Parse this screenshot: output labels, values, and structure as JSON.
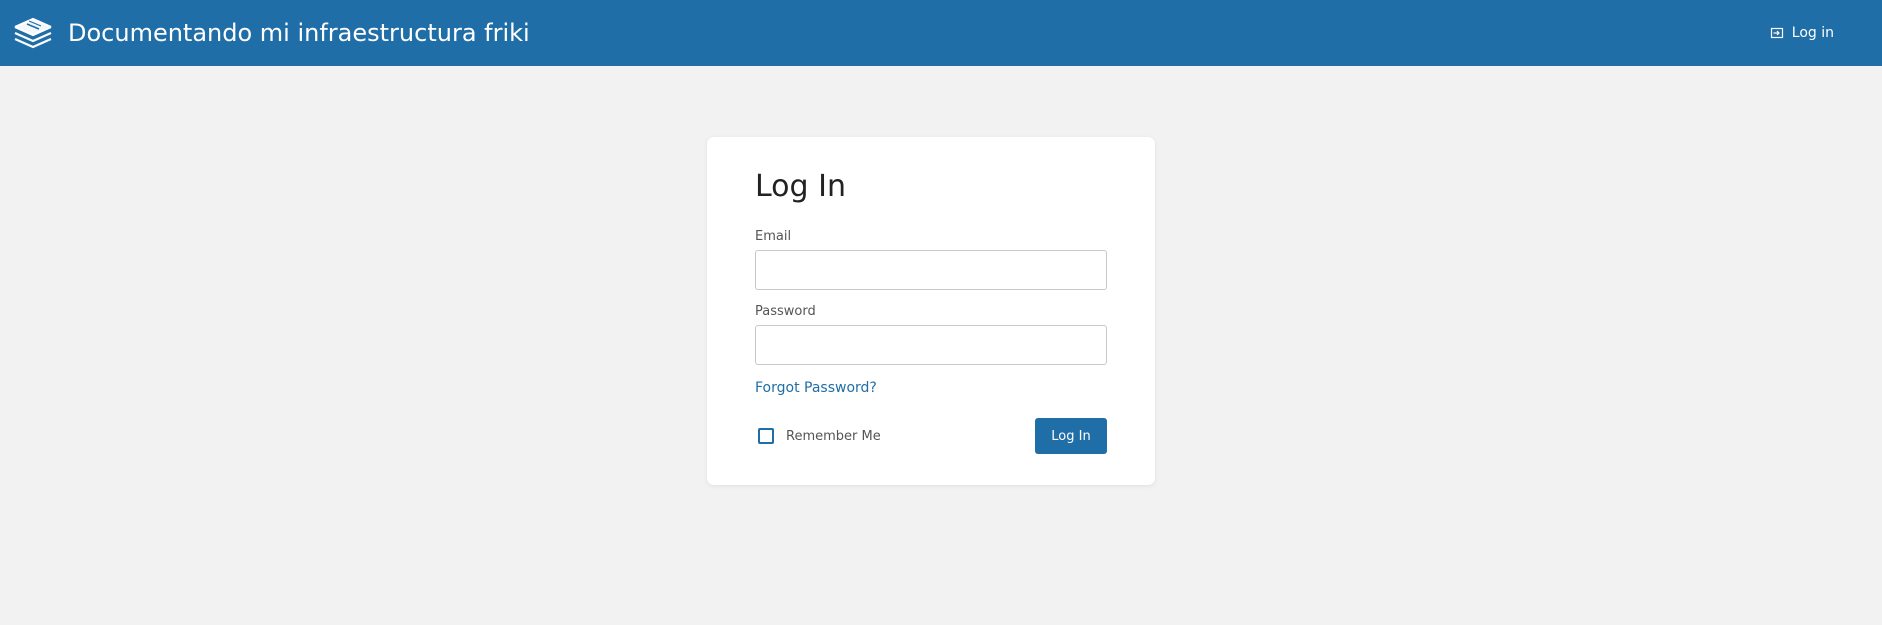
{
  "header": {
    "site_title": "Documentando mi infraestructura friki",
    "logo_icon": "books-stack-icon",
    "login_label": "Log in",
    "login_icon": "login-icon"
  },
  "login_form": {
    "title": "Log In",
    "email": {
      "label": "Email",
      "value": "",
      "placeholder": ""
    },
    "password": {
      "label": "Password",
      "value": "",
      "placeholder": ""
    },
    "forgot_password_label": "Forgot Password?",
    "remember_me": {
      "label": "Remember Me",
      "checked": false
    },
    "submit_label": "Log In"
  },
  "colors": {
    "primary": "#206ea7",
    "page_background": "#f2f2f2",
    "card_background": "#ffffff"
  }
}
